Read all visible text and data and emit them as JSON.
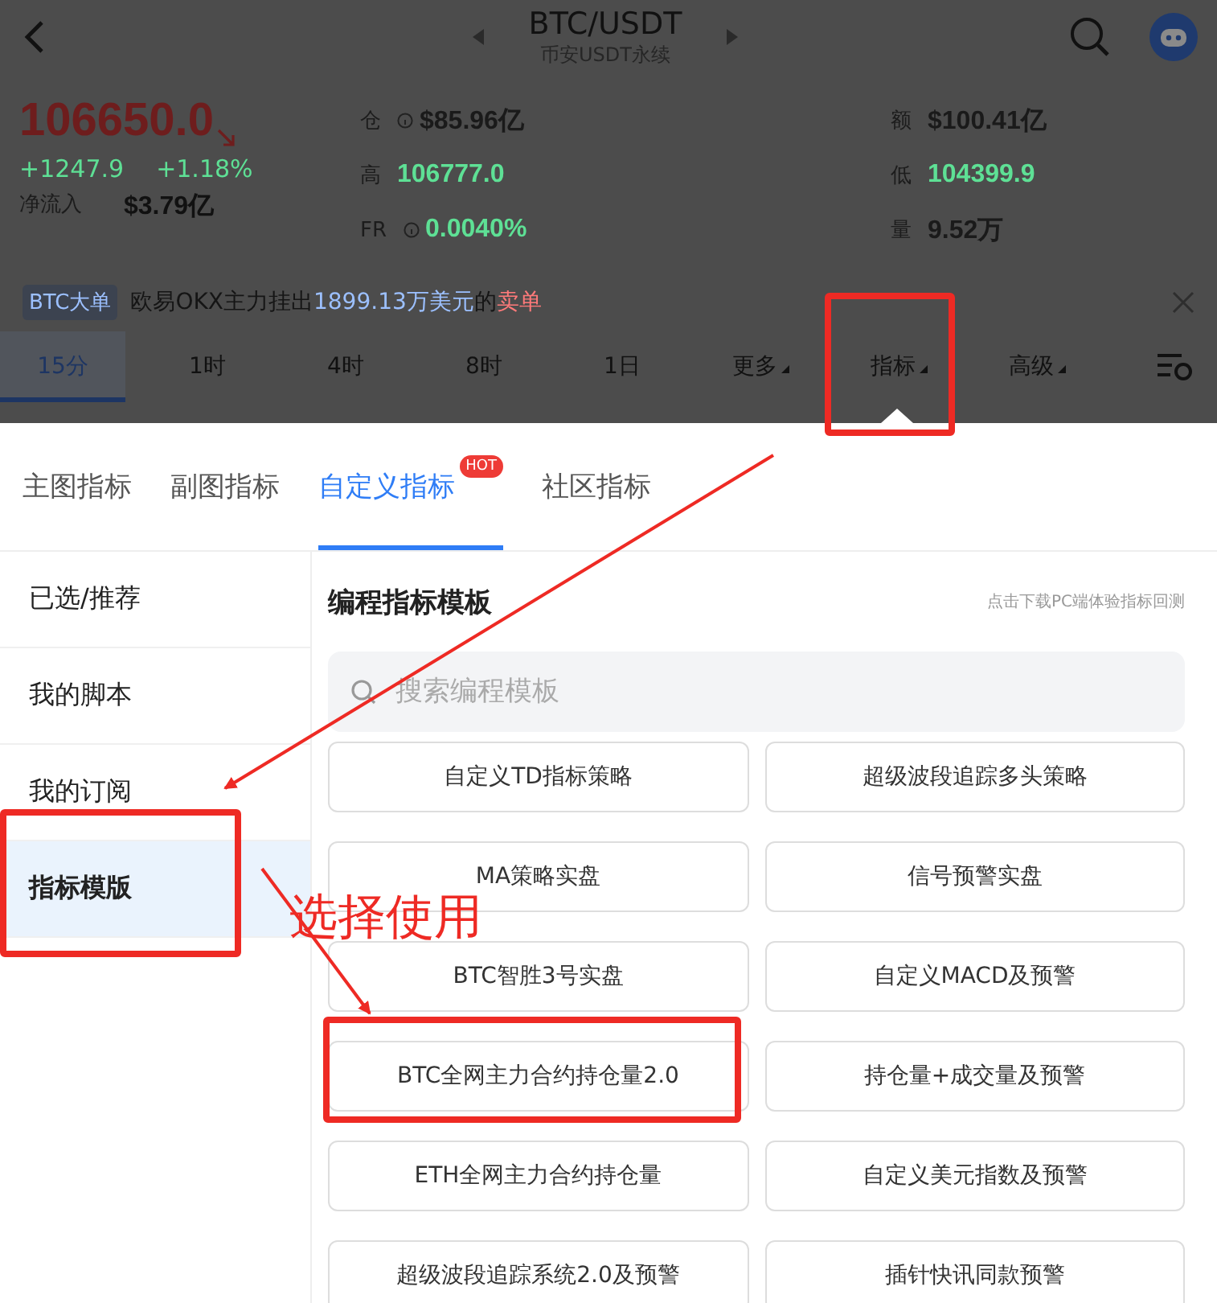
{
  "header": {
    "title": "BTC/USDT",
    "subtitle": "币安USDT永续"
  },
  "price": {
    "last": "106650.0",
    "change": "+1247.9",
    "change_pct": "+1.18%",
    "inflow_label": "净流入",
    "inflow": "$3.79亿"
  },
  "stats": [
    {
      "label": "仓",
      "info": true,
      "value": "$85.96亿",
      "color": "#1a1a1a"
    },
    {
      "label": "额",
      "info": false,
      "value": "$100.41亿",
      "color": "#1a1a1a"
    },
    {
      "label": "高",
      "info": false,
      "value": "106777.0",
      "color": "#5ee095"
    },
    {
      "label": "低",
      "info": false,
      "value": "104399.9",
      "color": "#5ee095"
    },
    {
      "label": "FR",
      "info": true,
      "value": "0.0040%",
      "color": "#5ee095"
    },
    {
      "label": "量",
      "info": false,
      "value": "9.52万",
      "color": "#1a1a1a"
    }
  ],
  "news": {
    "tag": "BTC大单",
    "segments": [
      {
        "text": "欧易OKX主力挂出",
        "kind": "plain"
      },
      {
        "text": "1899.13万美元",
        "kind": "amount"
      },
      {
        "text": "的",
        "kind": "plain"
      },
      {
        "text": "卖单",
        "kind": "sell"
      }
    ]
  },
  "timeframes": [
    {
      "label": "15分",
      "selected": true,
      "dropdown": false
    },
    {
      "label": "1时",
      "selected": false,
      "dropdown": false
    },
    {
      "label": "4时",
      "selected": false,
      "dropdown": false
    },
    {
      "label": "8时",
      "selected": false,
      "dropdown": false
    },
    {
      "label": "1日",
      "selected": false,
      "dropdown": false
    },
    {
      "label": "更多",
      "selected": false,
      "dropdown": true
    },
    {
      "label": "指标",
      "selected": false,
      "dropdown": true
    },
    {
      "label": "高级",
      "selected": false,
      "dropdown": true
    }
  ],
  "sheet_tabs": [
    {
      "label": "主图指标",
      "selected": false
    },
    {
      "label": "副图指标",
      "selected": false
    },
    {
      "label": "自定义指标",
      "selected": true,
      "badge": "HOT"
    },
    {
      "label": "社区指标",
      "selected": false
    }
  ],
  "sidebar": [
    {
      "label": "已选/推荐",
      "selected": false
    },
    {
      "label": "我的脚本",
      "selected": false
    },
    {
      "label": "我的订阅",
      "selected": false
    },
    {
      "label": "指标模版",
      "selected": true
    }
  ],
  "panel": {
    "title": "编程指标模板",
    "hint": "点击下载PC端体验指标回测",
    "search_placeholder": "搜索编程模板"
  },
  "templates": [
    "自定义TD指标策略",
    "超级波段追踪多头策略",
    "MA策略实盘",
    "信号预警实盘",
    "BTC智胜3号实盘",
    "自定义MACD及预警",
    "BTC全网主力合约持仓量2.0",
    "持仓量+成交量及预警",
    "ETH全网主力合约持仓量",
    "自定义美元指数及预警",
    "超级波段追踪系统2.0及预警",
    "插针快讯同款预警"
  ],
  "annotation": {
    "text": "选择使用"
  }
}
